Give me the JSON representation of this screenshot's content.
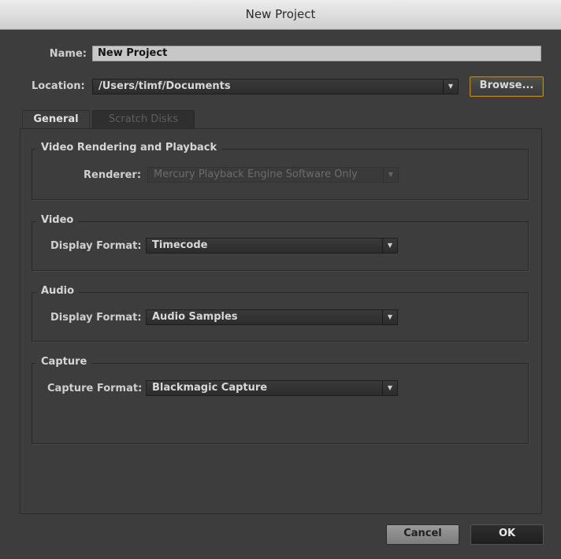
{
  "window": {
    "title": "New Project"
  },
  "name": {
    "label": "Name:",
    "value": "New Project"
  },
  "location": {
    "label": "Location:",
    "value": "/Users/timf/Documents",
    "browse_label": "Browse..."
  },
  "tabs": [
    {
      "label": "General",
      "active": true
    },
    {
      "label": "Scratch Disks",
      "active": false
    }
  ],
  "groups": {
    "video_rendering": {
      "title": "Video Rendering and Playback",
      "renderer_label": "Renderer:",
      "renderer_value": "Mercury Playback Engine Software Only",
      "enabled": false
    },
    "video": {
      "title": "Video",
      "format_label": "Display Format:",
      "format_value": "Timecode"
    },
    "audio": {
      "title": "Audio",
      "format_label": "Display Format:",
      "format_value": "Audio Samples"
    },
    "capture": {
      "title": "Capture",
      "format_label": "Capture Format:",
      "format_value": "Blackmagic Capture"
    }
  },
  "buttons": {
    "cancel": "Cancel",
    "ok": "OK"
  },
  "icons": {
    "dropdown_arrow": "chevron-down-icon"
  },
  "colors": {
    "window_bg": "#3d3d3d",
    "titlebar": "#dcdcdc",
    "focus_ring": "#b08a1c",
    "field_bg": "#c7c7c7"
  }
}
